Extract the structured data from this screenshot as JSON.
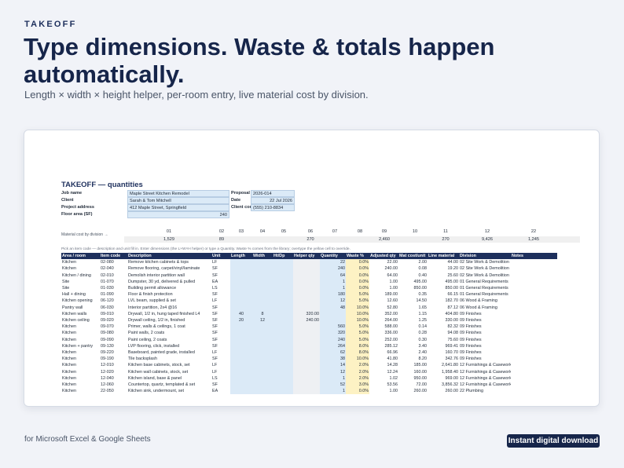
{
  "eyebrow": "TAKEOFF",
  "headline": "Type dimensions. Waste & totals happen automatically.",
  "subhead": "Length × width × height helper, per-room entry, live material cost by division.",
  "sheet": {
    "title": "TAKEOFF — quantities",
    "fields": {
      "job_name_label": "Job name",
      "job_name": "Maple Street Kitchen Remodel",
      "client_label": "Client",
      "client": "Sarah & Tom Mitchell",
      "address_label": "Project address",
      "address": "412 Maple Street, Springfield",
      "floor_label": "Floor area (SF)",
      "floor": "240",
      "proposal_label": "Proposal #",
      "proposal": "2026-014",
      "date_label": "Date",
      "date": "22 Jul 2026",
      "contact_label": "Client contact",
      "contact": "(555) 210-8834"
    },
    "division_caption": "Material cost by division →",
    "division_codes": [
      "01",
      "02",
      "03",
      "04",
      "05",
      "06",
      "07",
      "08",
      "09",
      "10",
      "11",
      "12",
      "22"
    ],
    "division_values": [
      "1,529",
      "89",
      "",
      "",
      "",
      "270",
      "",
      "",
      "2,460",
      "",
      "270",
      "9,426",
      "1,245"
    ],
    "note": "Pick an item code — description and unit fill in. Enter dimensions (the L×W×H helper) or type a Quantity. Waste % comes from the library; overtype the yellow cell to override.",
    "columns": [
      "Area / room",
      "Item code",
      "Description",
      "Unit",
      "Length",
      "Width",
      "Ht/Dp",
      "Helper qty",
      "Quantity",
      "Waste %",
      "Adjusted qty",
      "Mat cost/unit",
      "Line material",
      "Division",
      "Notes"
    ],
    "rows": [
      [
        "Kitchen",
        "02-080",
        "Remove kitchen cabinets & tops",
        "LF",
        "",
        "",
        "",
        "",
        "22",
        "0.0%",
        "22.00",
        "2.00",
        "44.00",
        "02 Site Work & Demolition",
        ""
      ],
      [
        "Kitchen",
        "02-040",
        "Remove flooring, carpet/vinyl/laminate",
        "SF",
        "",
        "",
        "",
        "",
        "240",
        "0.0%",
        "240.00",
        "0.08",
        "19.20",
        "02 Site Work & Demolition",
        ""
      ],
      [
        "Kitchen / dining",
        "02-010",
        "Demolish interior partition wall",
        "SF",
        "",
        "",
        "",
        "",
        "64",
        "0.0%",
        "64.00",
        "0.40",
        "25.60",
        "02 Site Work & Demolition",
        ""
      ],
      [
        "Site",
        "01-070",
        "Dumpster, 30 yd, delivered & pulled",
        "EA",
        "",
        "",
        "",
        "",
        "1",
        "0.0%",
        "1.00",
        "495.00",
        "495.00",
        "01 General Requirements",
        ""
      ],
      [
        "Site",
        "01-030",
        "Building permit allowance",
        "LS",
        "",
        "",
        "",
        "",
        "1",
        "0.0%",
        "1.00",
        "850.00",
        "850.00",
        "01 General Requirements",
        ""
      ],
      [
        "Hall + dining",
        "01-090",
        "Floor & finish protection",
        "SF",
        "",
        "",
        "",
        "",
        "180",
        "5.0%",
        "189.00",
        "0.35",
        "66.15",
        "01 General Requirements",
        ""
      ],
      [
        "Kitchen opening",
        "06-120",
        "LVL beam, supplied & set",
        "LF",
        "",
        "",
        "",
        "",
        "12",
        "5.0%",
        "12.60",
        "14.50",
        "182.70",
        "06 Wood & Framing",
        ""
      ],
      [
        "Pantry wall",
        "06-030",
        "Interior partition, 2x4 @16",
        "SF",
        "",
        "",
        "",
        "",
        "48",
        "10.0%",
        "52.80",
        "1.65",
        "87.12",
        "06 Wood & Framing",
        ""
      ],
      [
        "Kitchen walls",
        "09-010",
        "Drywall, 1/2 in, hung taped finished L4",
        "SF",
        "40",
        "8",
        "",
        "320.00",
        "",
        "10.0%",
        "352.00",
        "1.15",
        "404.80",
        "09 Finishes",
        ""
      ],
      [
        "Kitchen ceiling",
        "09-020",
        "Drywall ceiling, 1/2 in, finished",
        "SF",
        "20",
        "12",
        "",
        "240.00",
        "",
        "10.0%",
        "264.00",
        "1.25",
        "330.00",
        "09 Finishes",
        ""
      ],
      [
        "Kitchen",
        "09-070",
        "Primer, walls & ceilings, 1 coat",
        "SF",
        "",
        "",
        "",
        "",
        "560",
        "5.0%",
        "588.00",
        "0.14",
        "82.32",
        "09 Finishes",
        ""
      ],
      [
        "Kitchen",
        "09-080",
        "Paint walls, 2 coats",
        "SF",
        "",
        "",
        "",
        "",
        "320",
        "5.0%",
        "336.00",
        "0.28",
        "94.08",
        "09 Finishes",
        ""
      ],
      [
        "Kitchen",
        "09-090",
        "Paint ceiling, 2 coats",
        "SF",
        "",
        "",
        "",
        "",
        "240",
        "5.0%",
        "252.00",
        "0.30",
        "75.60",
        "09 Finishes",
        ""
      ],
      [
        "Kitchen + pantry",
        "09-130",
        "LVP flooring, click, installed",
        "SF",
        "",
        "",
        "",
        "",
        "264",
        "8.0%",
        "285.12",
        "3.40",
        "969.41",
        "09 Finishes",
        ""
      ],
      [
        "Kitchen",
        "09-220",
        "Baseboard, painted grade, installed",
        "LF",
        "",
        "",
        "",
        "",
        "62",
        "8.0%",
        "66.96",
        "2.40",
        "160.70",
        "09 Finishes",
        ""
      ],
      [
        "Kitchen",
        "09-190",
        "Tile backsplash",
        "SF",
        "",
        "",
        "",
        "",
        "38",
        "10.0%",
        "41.80",
        "8.20",
        "342.76",
        "09 Finishes",
        ""
      ],
      [
        "Kitchen",
        "12-010",
        "Kitchen base cabinets, stock, set",
        "LF",
        "",
        "",
        "",
        "",
        "14",
        "2.0%",
        "14.28",
        "185.00",
        "2,641.80",
        "12 Furnishings & Casework",
        ""
      ],
      [
        "Kitchen",
        "12-020",
        "Kitchen wall cabinets, stock, set",
        "LF",
        "",
        "",
        "",
        "",
        "12",
        "2.0%",
        "12.24",
        "160.00",
        "1,958.40",
        "12 Furnishings & Casework",
        ""
      ],
      [
        "Kitchen",
        "12-040",
        "Kitchen island, base & panel",
        "LS",
        "",
        "",
        "",
        "",
        "1",
        "2.0%",
        "1.02",
        "950.00",
        "969.00",
        "12 Furnishings & Casework",
        ""
      ],
      [
        "Kitchen",
        "12-060",
        "Countertop, quartz, templated & set",
        "SF",
        "",
        "",
        "",
        "",
        "52",
        "3.0%",
        "53.56",
        "72.00",
        "3,856.32",
        "12 Furnishings & Casework",
        ""
      ],
      [
        "Kitchen",
        "22-050",
        "Kitchen sink, undermount, set",
        "EA",
        "",
        "",
        "",
        "",
        "1",
        "0.0%",
        "1.00",
        "260.00",
        "260.00",
        "22 Plumbing",
        ""
      ]
    ]
  },
  "footer": "for Microsoft Excel & Google Sheets",
  "cta": "Instant digital download",
  "colors": {
    "navy": "#1d2f5c",
    "input_blue": "#dbeaf7",
    "waste_yellow": "#fdf2c4"
  }
}
